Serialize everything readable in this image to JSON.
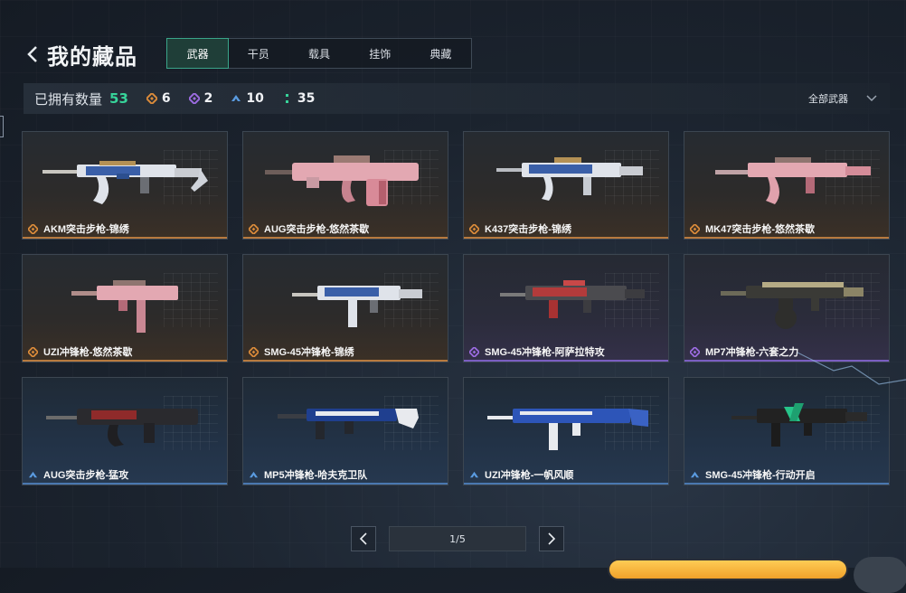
{
  "header": {
    "title": "我的藏品"
  },
  "tabs": [
    {
      "label": "武器",
      "active": true
    },
    {
      "label": "干员",
      "active": false
    },
    {
      "label": "载具",
      "active": false
    },
    {
      "label": "挂饰",
      "active": false
    },
    {
      "label": "典藏",
      "active": false
    }
  ],
  "stats": {
    "label": "已拥有数量",
    "total": "53",
    "counts": [
      {
        "icon": "orange-diamond-icon",
        "value": "6",
        "color": "#d98a3a"
      },
      {
        "icon": "purple-diamond-icon",
        "value": "2",
        "color": "#9b6be0"
      },
      {
        "icon": "blue-chevron-icon",
        "value": "10",
        "color": "#5a9be0"
      },
      {
        "icon": "green-dots-icon",
        "value": "35",
        "color": "#37d49a"
      }
    ]
  },
  "filter": {
    "label": "全部武器"
  },
  "items": [
    {
      "name": "AKM突击步枪-锦绣",
      "rarity": "orange"
    },
    {
      "name": "AUG突击步枪-悠然茶歇",
      "rarity": "orange"
    },
    {
      "name": "K437突击步枪-锦绣",
      "rarity": "orange"
    },
    {
      "name": "MK47突击步枪-悠然茶歇",
      "rarity": "orange"
    },
    {
      "name": "UZI冲锋枪-悠然茶歇",
      "rarity": "orange"
    },
    {
      "name": "SMG-45冲锋枪-锦绣",
      "rarity": "orange"
    },
    {
      "name": "SMG-45冲锋枪-阿萨拉特攻",
      "rarity": "purple"
    },
    {
      "name": "MP7冲锋枪-六套之力",
      "rarity": "purple"
    },
    {
      "name": "AUG突击步枪-猛攻",
      "rarity": "blue"
    },
    {
      "name": "MP5冲锋枪-哈夫克卫队",
      "rarity": "blue"
    },
    {
      "name": "UZI冲锋枪-一帆风顺",
      "rarity": "blue"
    },
    {
      "name": "SMG-45冲锋枪-行动开启",
      "rarity": "blue"
    }
  ],
  "pagination": {
    "page": "1/5"
  },
  "colors": {
    "accent": "#37d49a",
    "orange": "#b87a3f",
    "purple": "#7a5ec2",
    "blue": "#4a78b0"
  }
}
